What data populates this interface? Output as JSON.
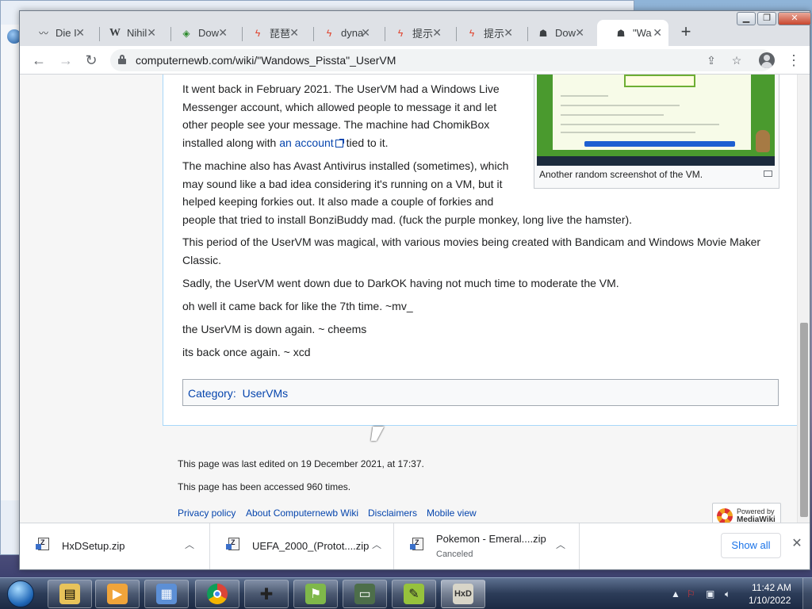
{
  "browser": {
    "tabs": [
      {
        "title": "Die I",
        "icon": "knife-icon"
      },
      {
        "title": "Nihil",
        "icon": "wikipedia-icon"
      },
      {
        "title": "Dow",
        "icon": "download-icon"
      },
      {
        "title": "琵琶",
        "icon": "bolt-icon"
      },
      {
        "title": "dyna",
        "icon": "bolt-icon"
      },
      {
        "title": "提示",
        "icon": "bolt-icon"
      },
      {
        "title": "提示",
        "icon": "bolt-icon"
      },
      {
        "title": "Dow",
        "icon": "hat-icon"
      },
      {
        "title": "\"Wa",
        "icon": "hat-icon",
        "active": true
      }
    ],
    "url": "computernewb.com/wiki/\"Wandows_Pissta\"_UserVM"
  },
  "article": {
    "p1_a": "It went back in February 2021. The UserVM had a Windows Live",
    "p1_b": "Messenger account, which allowed people to message it and let",
    "p1_c": "other people see your message. The machine had ChomikBox",
    "p1_d_pre": "installed along with ",
    "p1_d_link": "an account",
    "p1_d_post": " tied to it.",
    "p2_a": "The machine also has Avast Antivirus installed (sometimes), which",
    "p2_b": "may sound like a bad idea considering it's running on a VM, but it",
    "p2_c": "helped keeping forkies out. It also made a couple of forkies and",
    "p2_d": "people that tried to install BonziBuddy mad. (fuck the purple monkey, long live the hamster).",
    "p3_a": "This period of the UserVM was magical, with various movies being created with Bandicam and Windows Movie Maker",
    "p3_b": "Classic.",
    "p4": "Sadly, the UserVM went down due to DarkOK having not much time to moderate the VM.",
    "p5": "oh well it came back for like the 7th time. ~mv_",
    "p6": "the UserVM is down again. ~ cheems",
    "p7": "its back once again. ~ xcd",
    "thumb_caption": "Another random screenshot of the VM.",
    "category_label": "Category",
    "category_value": "UserVMs"
  },
  "footer": {
    "last_edited": "This page was last edited on 19 December 2021, at 17:37.",
    "accessed": "This page has been accessed 960 times.",
    "links": [
      "Privacy policy",
      "About Computernewb Wiki",
      "Disclaimers",
      "Mobile view"
    ],
    "powered_1": "Powered by",
    "powered_2": "MediaWiki"
  },
  "downloads": {
    "items": [
      {
        "name": "HxDSetup.zip",
        "status": ""
      },
      {
        "name": "UEFA_2000_(Protot....zip",
        "status": ""
      },
      {
        "name": "Pokemon - Emeral....zip",
        "status": "Canceled"
      }
    ],
    "show_all": "Show all"
  },
  "taskbar": {
    "time": "11:42 AM",
    "date": "1/10/2022"
  }
}
